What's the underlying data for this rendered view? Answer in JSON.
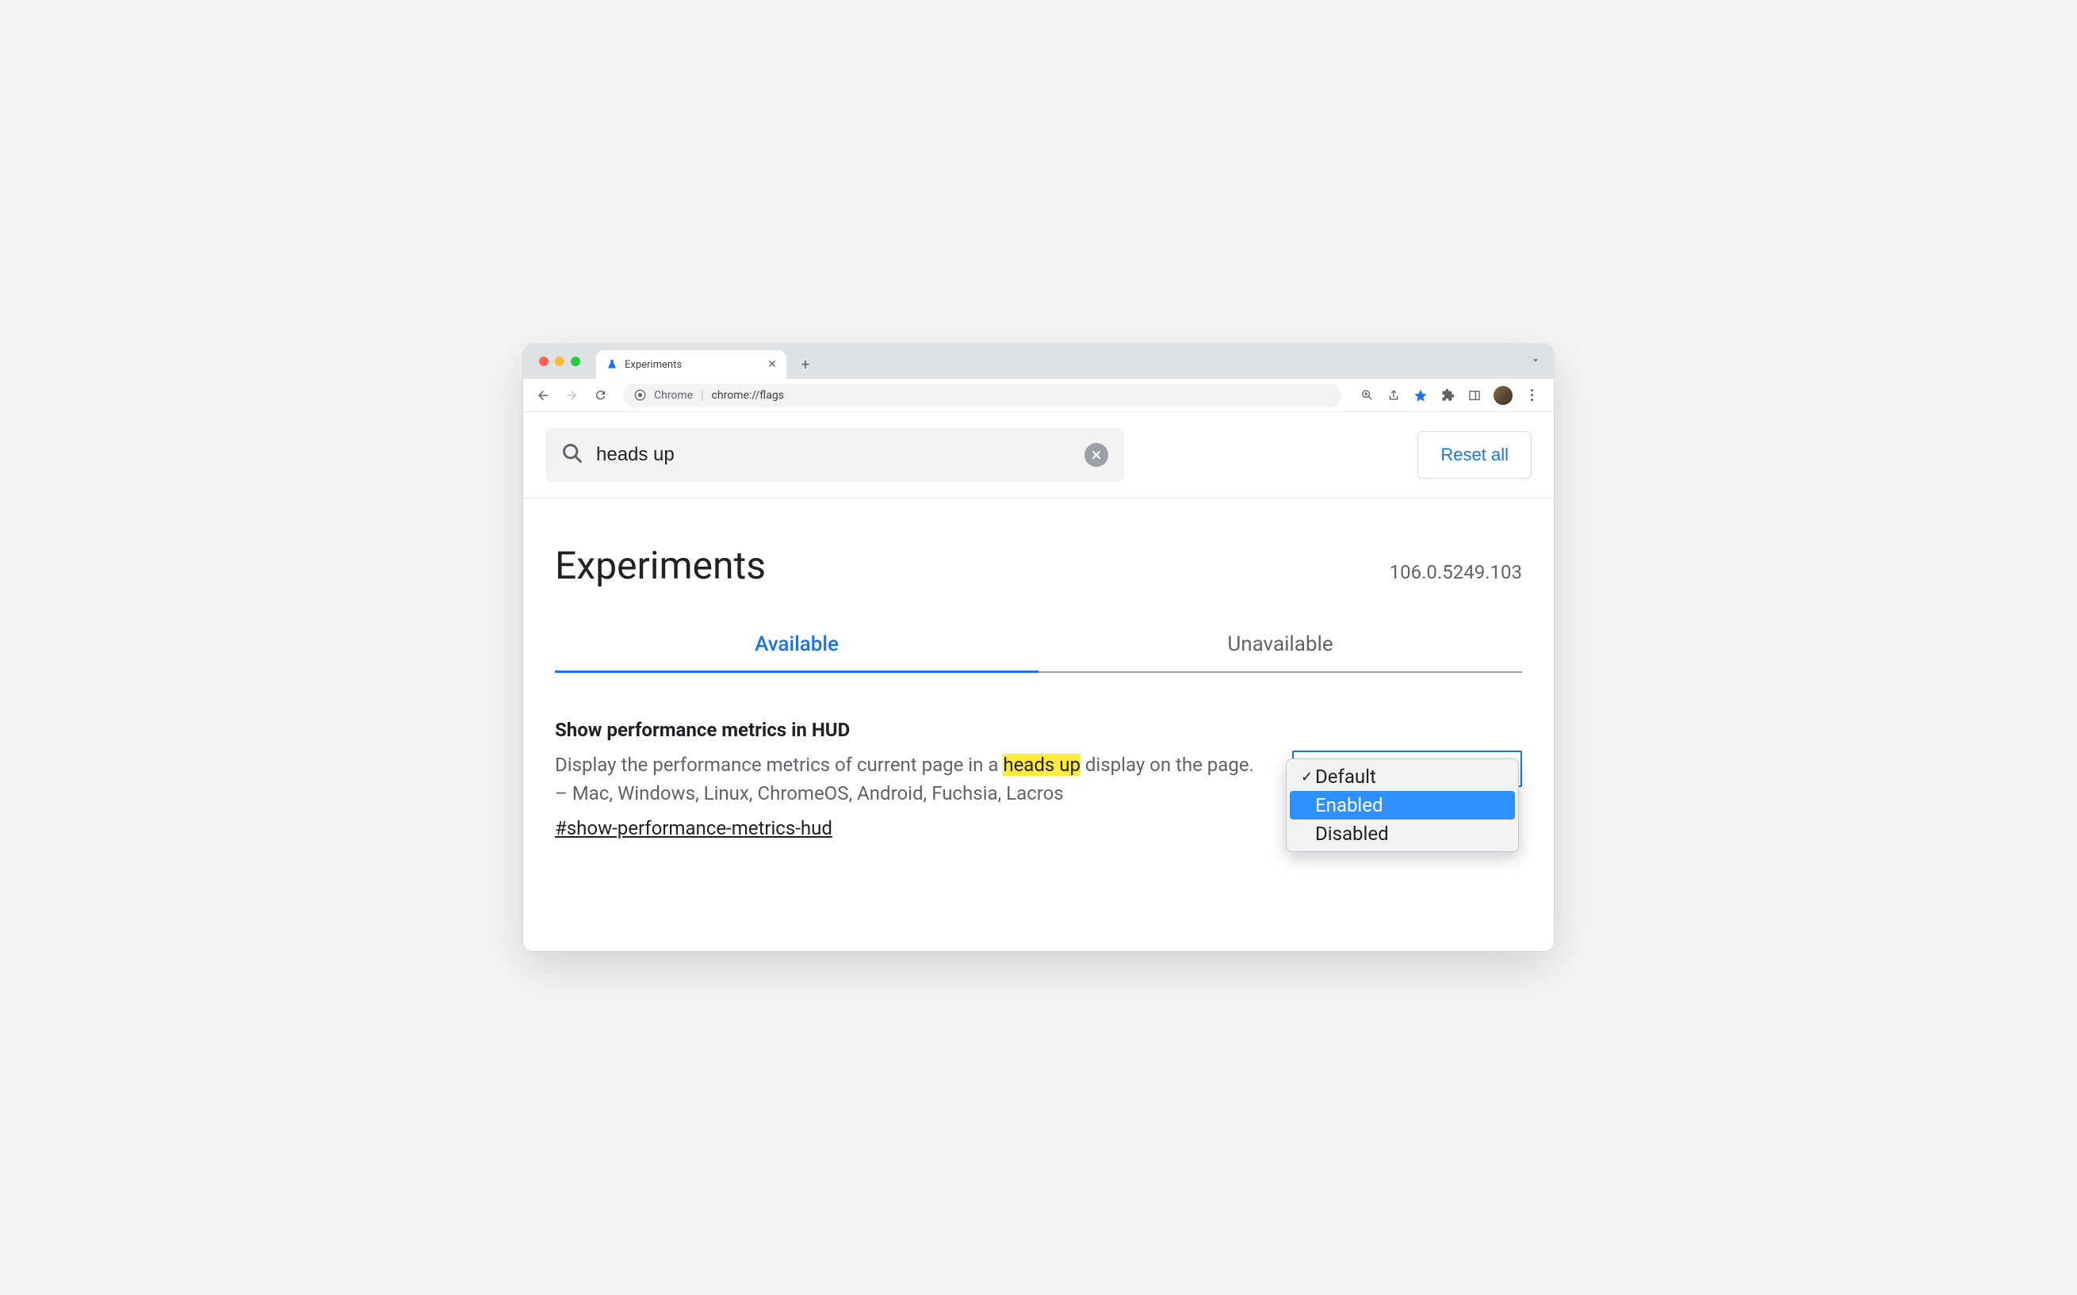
{
  "browser": {
    "tab_title": "Experiments",
    "omnibox_prefix": "Chrome",
    "omnibox_url": "chrome://flags"
  },
  "search": {
    "value": "heads up",
    "reset_label": "Reset all"
  },
  "header": {
    "title": "Experiments",
    "version": "106.0.5249.103"
  },
  "tabs": {
    "available": "Available",
    "unavailable": "Unavailable"
  },
  "flag": {
    "title": "Show performance metrics in HUD",
    "desc_before": "Display the performance metrics of current page in a ",
    "desc_highlight": "heads up",
    "desc_after": " display on the page. – Mac, Windows, Linux, ChromeOS, Android, Fuchsia, Lacros",
    "hash": "#show-performance-metrics-hud",
    "options": {
      "default": "Default",
      "enabled": "Enabled",
      "disabled": "Disabled"
    }
  }
}
